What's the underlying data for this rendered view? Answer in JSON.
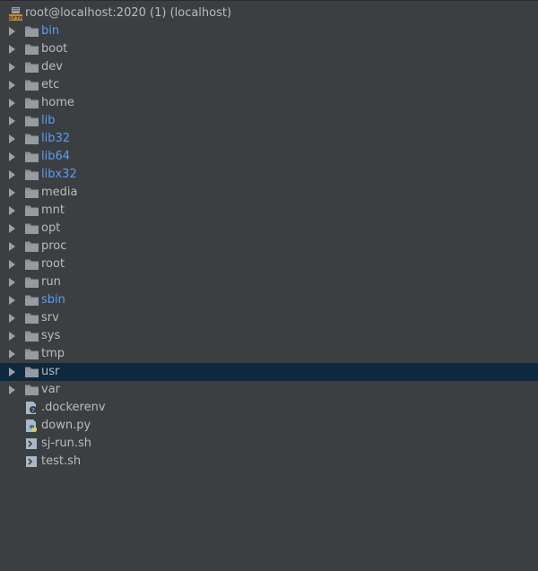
{
  "root": {
    "label": "root@localhost:2020 (1) (localhost)",
    "icon": "sftp-server-icon"
  },
  "colors": {
    "background": "#3c3f41",
    "text": "#bbbbbb",
    "link_text": "#589df6",
    "selection": "#0d293e",
    "folder": "#8a9199"
  },
  "items": [
    {
      "label": "bin",
      "type": "folder",
      "link": true,
      "expandable": true
    },
    {
      "label": "boot",
      "type": "folder",
      "link": false,
      "expandable": true
    },
    {
      "label": "dev",
      "type": "folder",
      "link": false,
      "expandable": true
    },
    {
      "label": "etc",
      "type": "folder",
      "link": false,
      "expandable": true
    },
    {
      "label": "home",
      "type": "folder",
      "link": false,
      "expandable": true
    },
    {
      "label": "lib",
      "type": "folder",
      "link": true,
      "expandable": true
    },
    {
      "label": "lib32",
      "type": "folder",
      "link": true,
      "expandable": true
    },
    {
      "label": "lib64",
      "type": "folder",
      "link": true,
      "expandable": true
    },
    {
      "label": "libx32",
      "type": "folder",
      "link": true,
      "expandable": true
    },
    {
      "label": "media",
      "type": "folder",
      "link": false,
      "expandable": true
    },
    {
      "label": "mnt",
      "type": "folder",
      "link": false,
      "expandable": true
    },
    {
      "label": "opt",
      "type": "folder",
      "link": false,
      "expandable": true
    },
    {
      "label": "proc",
      "type": "folder",
      "link": false,
      "expandable": true
    },
    {
      "label": "root",
      "type": "folder",
      "link": false,
      "expandable": true
    },
    {
      "label": "run",
      "type": "folder",
      "link": false,
      "expandable": true
    },
    {
      "label": "sbin",
      "type": "folder",
      "link": true,
      "expandable": true
    },
    {
      "label": "srv",
      "type": "folder",
      "link": false,
      "expandable": true
    },
    {
      "label": "sys",
      "type": "folder",
      "link": false,
      "expandable": true
    },
    {
      "label": "tmp",
      "type": "folder",
      "link": false,
      "expandable": true
    },
    {
      "label": "usr",
      "type": "folder",
      "link": false,
      "expandable": true,
      "selected": true
    },
    {
      "label": "var",
      "type": "folder",
      "link": false,
      "expandable": true
    },
    {
      "label": ".dockerenv",
      "type": "unknown-file",
      "link": false,
      "expandable": false
    },
    {
      "label": "down.py",
      "type": "python-file",
      "link": false,
      "expandable": false
    },
    {
      "label": "sj-run.sh",
      "type": "shell-file",
      "link": false,
      "expandable": false
    },
    {
      "label": "test.sh",
      "type": "shell-file",
      "link": false,
      "expandable": false
    }
  ]
}
